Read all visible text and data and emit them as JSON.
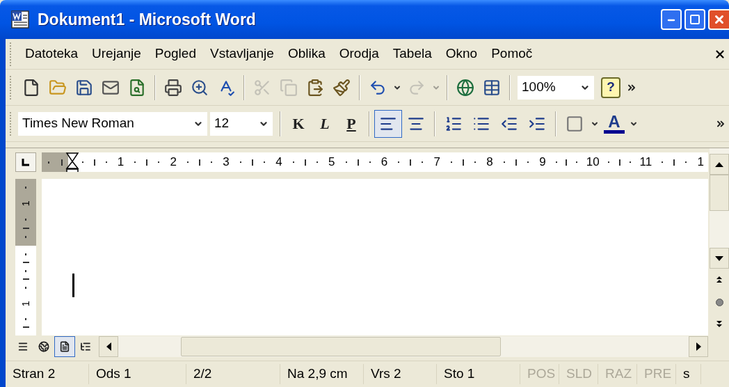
{
  "window": {
    "title": "Dokument1 - Microsoft Word"
  },
  "menu": [
    {
      "label": "Datoteka"
    },
    {
      "label": "Urejanje"
    },
    {
      "label": "Pogled"
    },
    {
      "label": "Vstavljanje"
    },
    {
      "label": "Oblika"
    },
    {
      "label": "Orodja"
    },
    {
      "label": "Tabela"
    },
    {
      "label": "Okno"
    },
    {
      "label": "Pomoč"
    }
  ],
  "standard_toolbar": [
    {
      "kind": "button",
      "disabled": false
    },
    {
      "kind": "button",
      "disabled": false
    },
    {
      "kind": "button",
      "disabled": false
    },
    {
      "kind": "button",
      "disabled": false
    },
    {
      "kind": "button",
      "disabled": false
    },
    {
      "kind": "separator"
    },
    {
      "kind": "button",
      "disabled": false
    },
    {
      "kind": "button",
      "disabled": false
    },
    {
      "kind": "button",
      "disabled": false
    },
    {
      "kind": "separator"
    },
    {
      "kind": "button",
      "disabled": true
    },
    {
      "kind": "button",
      "disabled": true
    },
    {
      "kind": "button",
      "disabled": false
    },
    {
      "kind": "button",
      "disabled": false
    },
    {
      "kind": "separator"
    },
    {
      "kind": "button",
      "disabled": false
    },
    {
      "kind": "caret",
      "disabled": false
    },
    {
      "kind": "button",
      "disabled": true
    },
    {
      "kind": "caret",
      "disabled": true
    },
    {
      "kind": "separator"
    },
    {
      "kind": "button",
      "disabled": false
    },
    {
      "kind": "button",
      "disabled": false
    },
    {
      "kind": "separator"
    },
    {
      "kind": "combo",
      "value": "100%"
    },
    {
      "kind": "help",
      "label": "?"
    },
    {
      "kind": "overflow"
    }
  ],
  "formatting_toolbar": [
    {
      "kind": "font",
      "value": "Times New Roman"
    },
    {
      "kind": "size",
      "value": "12"
    },
    {
      "kind": "separator"
    },
    {
      "kind": "text-button",
      "label": "K",
      "selected": false
    },
    {
      "kind": "text-button",
      "label": "L",
      "selected": false
    },
    {
      "kind": "text-button",
      "label": "P",
      "selected": false
    },
    {
      "kind": "separator"
    },
    {
      "kind": "button",
      "selected": true
    },
    {
      "kind": "button",
      "selected": false
    },
    {
      "kind": "separator"
    },
    {
      "kind": "button",
      "selected": false
    },
    {
      "kind": "button",
      "selected": false
    },
    {
      "kind": "button",
      "selected": false
    },
    {
      "kind": "button",
      "selected": false
    },
    {
      "kind": "separator"
    },
    {
      "kind": "button",
      "selected": false
    },
    {
      "kind": "caret"
    },
    {
      "kind": "color-button",
      "label": "A",
      "selected": false
    },
    {
      "kind": "caret"
    },
    {
      "kind": "overflow"
    }
  ],
  "ruler": {
    "numbers": [
      "1",
      "2",
      "3",
      "4",
      "5",
      "6",
      "7",
      "8",
      "9",
      "10",
      "11",
      "1"
    ]
  },
  "vertical_ruler": {
    "numbers": [
      "1",
      "1"
    ]
  },
  "view_buttons": [
    {
      "selected": false
    },
    {
      "selected": false
    },
    {
      "selected": true
    },
    {
      "selected": false
    }
  ],
  "status_bar": [
    {
      "label": "Stran 2",
      "disabled": false
    },
    {
      "label": "Ods 1",
      "disabled": false
    },
    {
      "label": "2/2",
      "disabled": false
    },
    {
      "label": "Na 2,9 cm",
      "disabled": false
    },
    {
      "label": "Vrs 2",
      "disabled": false
    },
    {
      "label": "Sto 1",
      "disabled": false
    },
    {
      "label": "POS",
      "disabled": true
    },
    {
      "label": "SLD",
      "disabled": true
    },
    {
      "label": "RAZ",
      "disabled": true
    },
    {
      "label": "PRE",
      "disabled": true
    },
    {
      "label": "s",
      "disabled": false
    }
  ]
}
